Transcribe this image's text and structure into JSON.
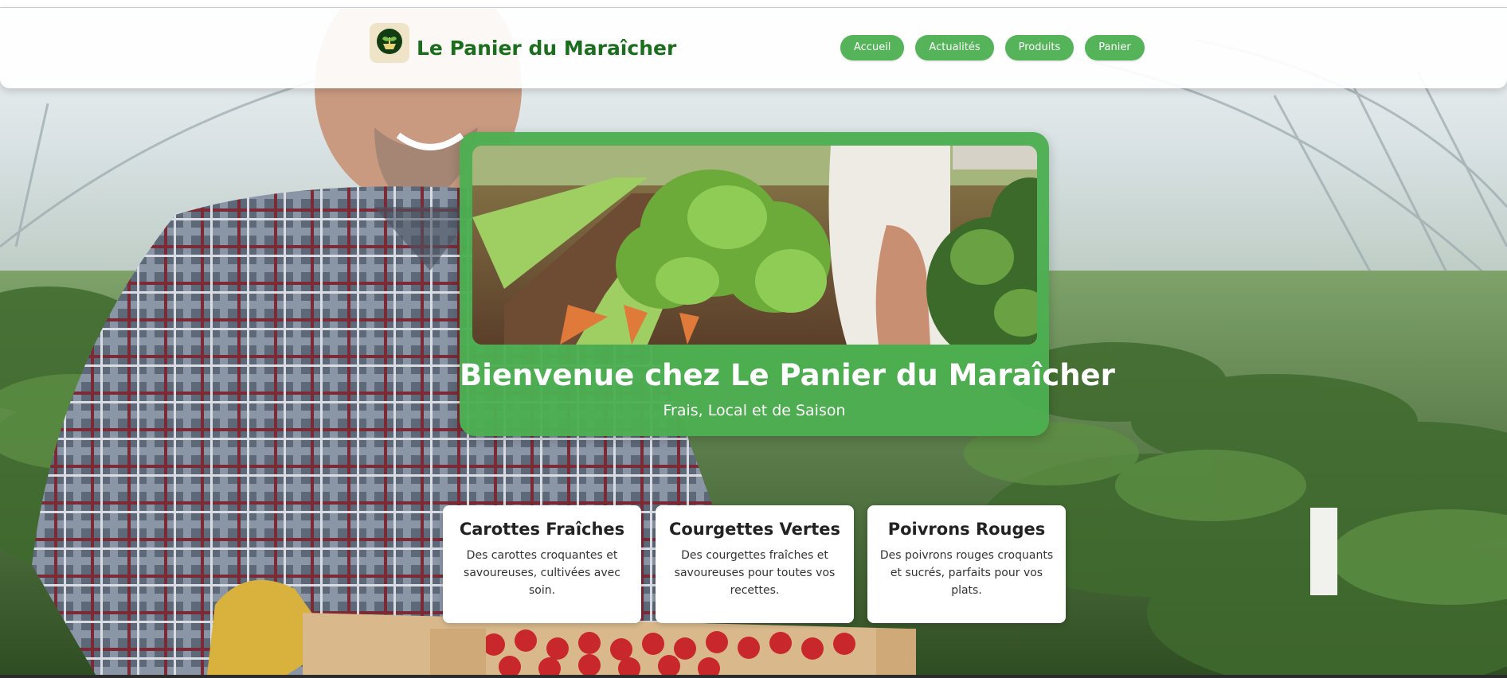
{
  "header": {
    "site_title": "Le Panier du Maraîcher",
    "logo_icon": "leaf-basket-icon",
    "nav": [
      {
        "label": "Accueil"
      },
      {
        "label": "Actualités"
      },
      {
        "label": "Produits"
      },
      {
        "label": "Panier"
      }
    ]
  },
  "hero": {
    "title": "Bienvenue chez Le Panier du Maraîcher",
    "subtitle": "Frais, Local et de Saison"
  },
  "products": [
    {
      "title": "Carottes Fraîches",
      "description": "Des carottes croquantes et savoureuses, cultivées avec soin."
    },
    {
      "title": "Courgettes Vertes",
      "description": "Des courgettes fraîches et savoureuses pour toutes vos recettes."
    },
    {
      "title": "Poivrons Rouges",
      "description": "Des poivrons rouges croquants et sucrés, parfaits pour vos plats."
    }
  ],
  "colors": {
    "brand_green": "#1b6e1d",
    "accent_green": "#4caf50",
    "nav_green": "#55b35a"
  }
}
